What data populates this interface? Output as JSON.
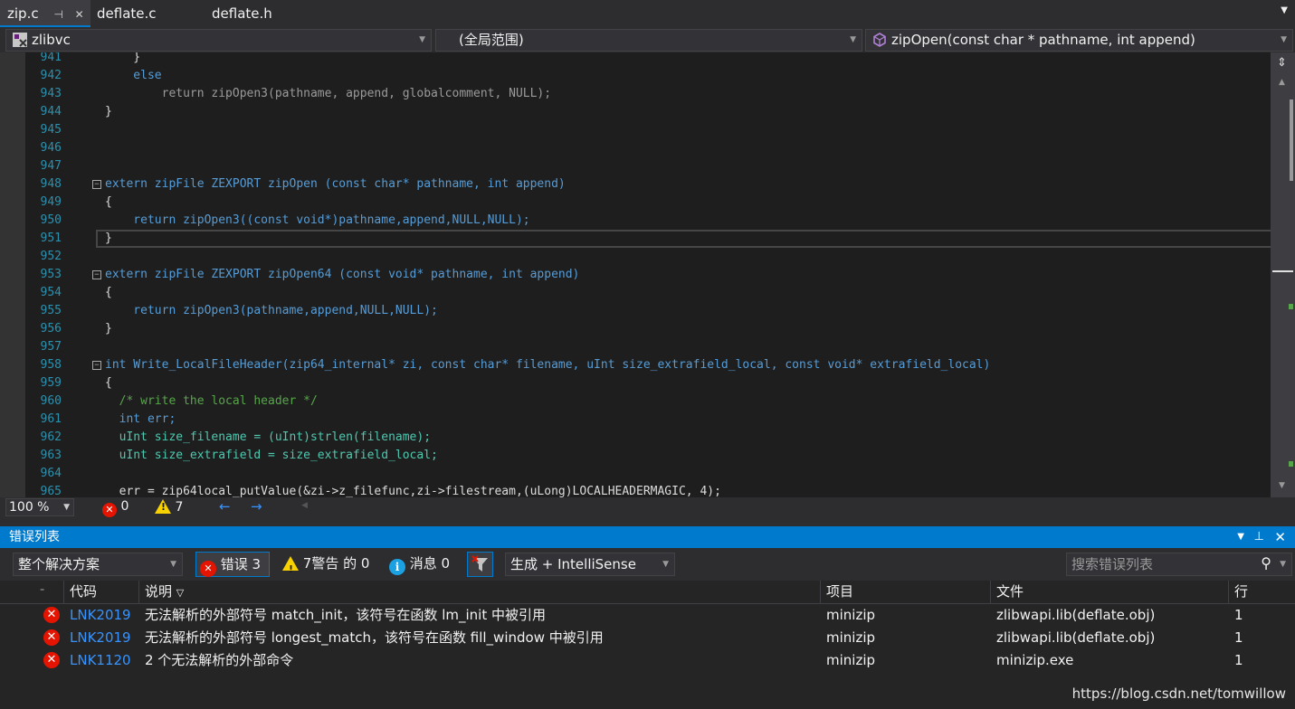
{
  "tabs": [
    {
      "label": "zip.c",
      "active": true
    },
    {
      "label": "deflate.c",
      "active": false
    },
    {
      "label": "deflate.h",
      "active": false
    }
  ],
  "nav": {
    "project": "zlibvc",
    "scope": "(全局范围)",
    "member": "zipOpen(const char * pathname, int append)"
  },
  "code_lines": [
    {
      "n": "941",
      "text": "    }"
    },
    {
      "n": "942",
      "text": "    else"
    },
    {
      "n": "943",
      "text": "        return zipOpen3(pathname, append, globalcomment, NULL);"
    },
    {
      "n": "944",
      "text": "}"
    },
    {
      "n": "945",
      "text": ""
    },
    {
      "n": "946",
      "text": ""
    },
    {
      "n": "947",
      "text": ""
    },
    {
      "n": "948",
      "text": "extern zipFile ZEXPORT zipOpen (const char* pathname, int append)"
    },
    {
      "n": "949",
      "text": "{"
    },
    {
      "n": "950",
      "text": "    return zipOpen3((const void*)pathname,append,NULL,NULL);"
    },
    {
      "n": "951",
      "text": "}"
    },
    {
      "n": "952",
      "text": ""
    },
    {
      "n": "953",
      "text": "extern zipFile ZEXPORT zipOpen64 (const void* pathname, int append)"
    },
    {
      "n": "954",
      "text": "{"
    },
    {
      "n": "955",
      "text": "    return zipOpen3(pathname,append,NULL,NULL);"
    },
    {
      "n": "956",
      "text": "}"
    },
    {
      "n": "957",
      "text": ""
    },
    {
      "n": "958",
      "text": "int Write_LocalFileHeader(zip64_internal* zi, const char* filename, uInt size_extrafield_local, const void* extrafield_local)"
    },
    {
      "n": "959",
      "text": "{"
    },
    {
      "n": "960",
      "text": "  /* write the local header */"
    },
    {
      "n": "961",
      "text": "  int err;"
    },
    {
      "n": "962",
      "text": "  uInt size_filename = (uInt)strlen(filename);"
    },
    {
      "n": "963",
      "text": "  uInt size_extrafield = size_extrafield_local;"
    },
    {
      "n": "964",
      "text": ""
    },
    {
      "n": "965",
      "text": "  err = zip64local_putValue(&zi->z_filefunc,zi->filestream,(uLong)LOCALHEADERMAGIC, 4);"
    }
  ],
  "editor_status": {
    "zoom": "100 %",
    "errors": "0",
    "warnings": "7"
  },
  "error_panel": {
    "title": "错误列表",
    "scope": "整个解决方案",
    "errors_btn": "错误 3",
    "warnings_btn": "7警告 的 0",
    "messages_btn": "消息 0",
    "build_filter": "生成 + IntelliSense",
    "search_placeholder": "搜索错误列表",
    "columns": {
      "code": "代码",
      "desc": "说明",
      "project": "项目",
      "file": "文件",
      "line": "行"
    },
    "rows": [
      {
        "code": "LNK2019",
        "desc": "无法解析的外部符号 match_init，该符号在函数 lm_init 中被引用",
        "project": "minizip",
        "file": "zlibwapi.lib(deflate.obj)",
        "line": "1"
      },
      {
        "code": "LNK2019",
        "desc": "无法解析的外部符号 longest_match，该符号在函数 fill_window 中被引用",
        "project": "minizip",
        "file": "zlibwapi.lib(deflate.obj)",
        "line": "1"
      },
      {
        "code": "LNK1120",
        "desc": "2 个无法解析的外部命令",
        "project": "minizip",
        "file": "minizip.exe",
        "line": "1"
      }
    ]
  },
  "watermark": "https://blog.csdn.net/tomwillow",
  "colors": {
    "accent": "#007acc",
    "error": "#e51400",
    "warning": "#f8d100",
    "info": "#1ba1e2",
    "link": "#3794ff",
    "linenum": "#2b91af"
  }
}
